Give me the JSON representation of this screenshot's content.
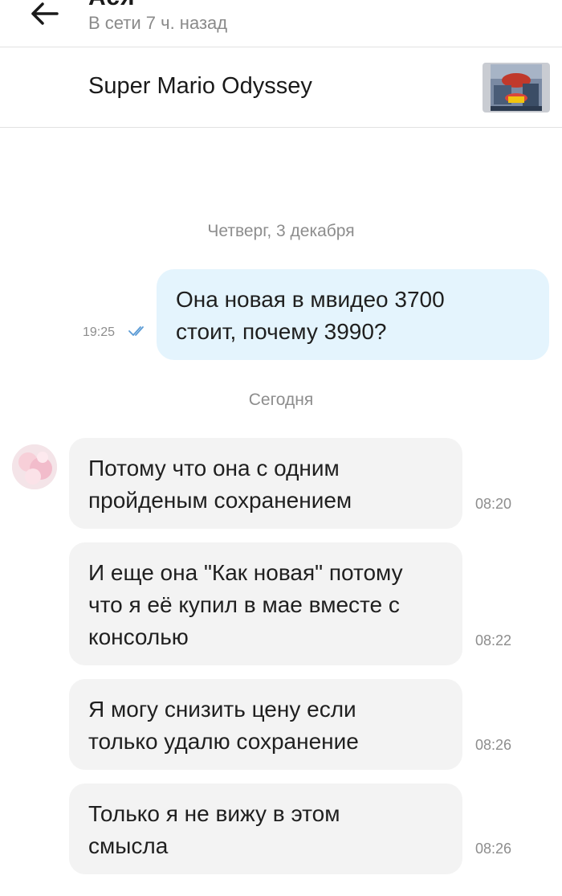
{
  "header": {
    "contact_name": "Ася",
    "status": "В сети 7 ч. назад"
  },
  "item": {
    "title": "Super Mario Odyssey",
    "thumbnail_icon": "game-cover-thumbnail"
  },
  "dates": {
    "first": "Четверг, 3 декабря",
    "second": "Сегодня"
  },
  "outgoing": {
    "line1": "Она новая в мвидео 3700",
    "line2": "стоит, почему 3990?",
    "time": "19:25",
    "read_icon": "double-check-icon"
  },
  "incoming": [
    {
      "lines": [
        "Потому что она с одним",
        "пройденым сохранением"
      ],
      "time": "08:20"
    },
    {
      "lines": [
        "И еще она \"Как новая\" потому",
        "что я её купил в мае вместе с",
        "консолью"
      ],
      "time": "08:22"
    },
    {
      "lines": [
        "Я могу снизить цену если",
        "только удалю сохранение"
      ],
      "time": "08:26"
    },
    {
      "lines": [
        "Только я не вижу в этом",
        "смысла"
      ],
      "time": "08:26"
    }
  ],
  "colors": {
    "outgoing_bubble": "#e4f4fd",
    "incoming_bubble": "#f3f3f3",
    "read_check": "#5b9bd5"
  }
}
